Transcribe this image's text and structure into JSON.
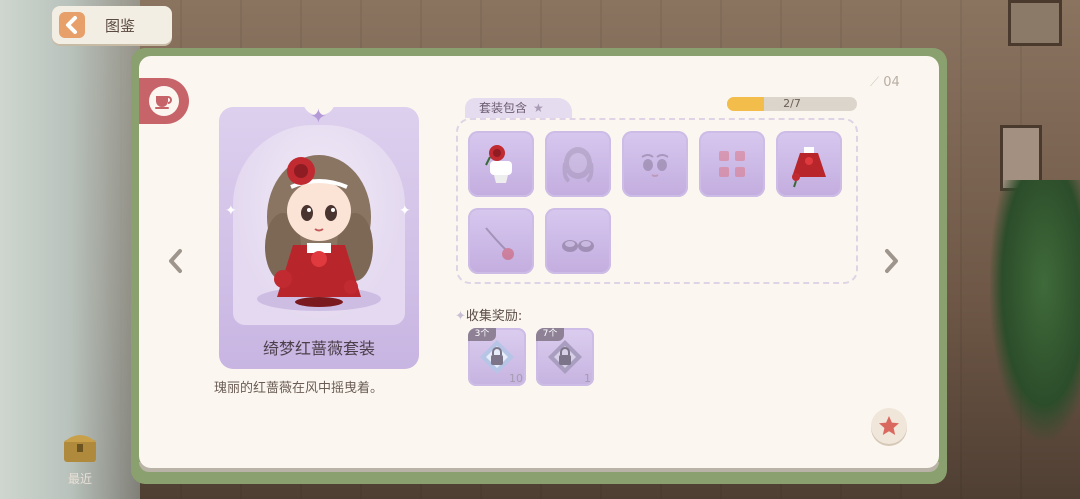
{
  "header": {
    "title": "图鉴"
  },
  "page": {
    "number": "04"
  },
  "outfit": {
    "name": "绮梦红蔷薇套装",
    "description": "瑰丽的红蔷薇在风中摇曳着。"
  },
  "set_contents": {
    "label": "套装包含",
    "progress_text": "2/7",
    "progress_fraction": 0.2857,
    "items": [
      {
        "icon": "hair-accessory-icon",
        "collected": true
      },
      {
        "icon": "hairstyle-icon",
        "collected": false
      },
      {
        "icon": "face-makeup-icon",
        "collected": false
      },
      {
        "icon": "earrings-icon",
        "collected": false
      },
      {
        "icon": "dress-icon",
        "collected": true
      },
      {
        "icon": "handheld-rose-icon",
        "collected": false
      },
      {
        "icon": "shoes-icon",
        "collected": false
      }
    ]
  },
  "rewards": {
    "label": "收集奖励:",
    "items": [
      {
        "tag": "3个",
        "count": "10",
        "icon": "locked-diamond-icon"
      },
      {
        "tag": "7个",
        "count": "1",
        "icon": "locked-gem-icon"
      }
    ]
  },
  "bottom": {
    "recent_label": "最近"
  },
  "colors": {
    "accent": "#c7646a",
    "panel": "#fbf7f0",
    "card": "#c8b5e2",
    "progress": "#f2bd4a"
  }
}
